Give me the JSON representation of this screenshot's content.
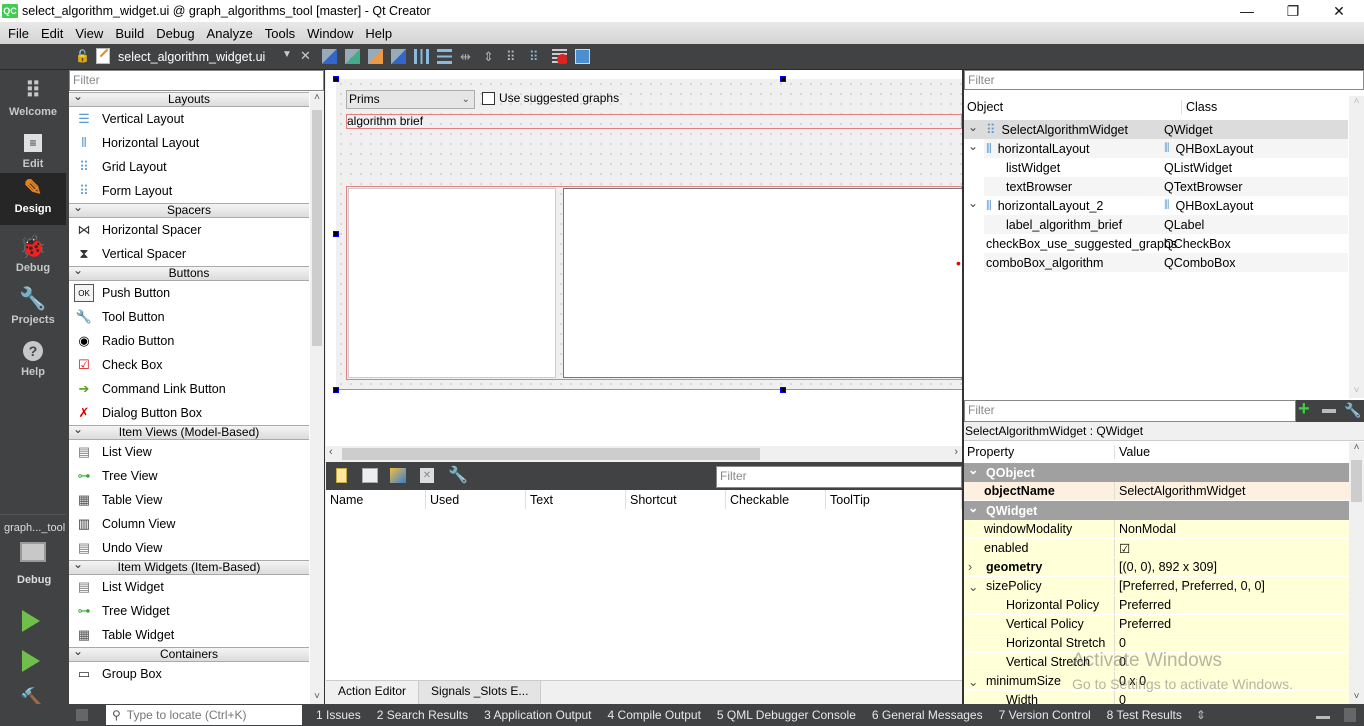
{
  "window": {
    "title": "select_algorithm_widget.ui @ graph_algorithms_tool [master] - Qt Creator",
    "app_icon": "QC",
    "minimize": "—",
    "restore": "❐",
    "close": "✕"
  },
  "menu": [
    "File",
    "Edit",
    "View",
    "Build",
    "Debug",
    "Analyze",
    "Tools",
    "Window",
    "Help"
  ],
  "doc_toolbar": {
    "file_name": "select_algorithm_widget.ui",
    "close_label": "✕"
  },
  "modes": [
    {
      "label": "Welcome",
      "icon": "grid-icon"
    },
    {
      "label": "Edit",
      "icon": "document-icon"
    },
    {
      "label": "Design",
      "icon": "pencil-icon"
    },
    {
      "label": "Debug",
      "icon": "bug-icon"
    },
    {
      "label": "Projects",
      "icon": "wrench-icon"
    },
    {
      "label": "Help",
      "icon": "help-icon"
    }
  ],
  "kit": {
    "project": "graph..._tool",
    "build": "Debug"
  },
  "widget_box": {
    "filter_placeholder": "Filter",
    "categories": [
      {
        "name": "Layouts",
        "items": [
          "Vertical Layout",
          "Horizontal Layout",
          "Grid Layout",
          "Form Layout"
        ]
      },
      {
        "name": "Spacers",
        "items": [
          "Horizontal Spacer",
          "Vertical Spacer"
        ]
      },
      {
        "name": "Buttons",
        "items": [
          "Push Button",
          "Tool Button",
          "Radio Button",
          "Check Box",
          "Command Link Button",
          "Dialog Button Box"
        ]
      },
      {
        "name": "Item Views (Model-Based)",
        "items": [
          "List View",
          "Tree View",
          "Table View",
          "Column View",
          "Undo View"
        ]
      },
      {
        "name": "Item Widgets (Item-Based)",
        "items": [
          "List Widget",
          "Tree Widget",
          "Table Widget"
        ]
      },
      {
        "name": "Containers",
        "items": [
          "Group Box"
        ]
      }
    ]
  },
  "form": {
    "combo_value": "Prims",
    "checkbox_label": "Use suggested graphs",
    "checkbox_checked": false,
    "label_text": "algorithm brief"
  },
  "action_editor": {
    "filter_placeholder": "Filter",
    "columns": [
      "Name",
      "Used",
      "Text",
      "Shortcut",
      "Checkable",
      "ToolTip"
    ],
    "tabs": [
      "Action Editor",
      "Signals _Slots E..."
    ]
  },
  "object_inspector": {
    "filter_placeholder": "Filter",
    "columns": [
      "Object",
      "Class"
    ],
    "rows": [
      {
        "name": "SelectAlgorithmWidget",
        "class": "QWidget"
      },
      {
        "name": "horizontalLayout",
        "class": "QHBoxLayout"
      },
      {
        "name": "listWidget",
        "class": "QListWidget"
      },
      {
        "name": "textBrowser",
        "class": "QTextBrowser"
      },
      {
        "name": "horizontalLayout_2",
        "class": "QHBoxLayout"
      },
      {
        "name": "label_algorithm_brief",
        "class": "QLabel"
      },
      {
        "name": "checkBox_use_suggested_graphs",
        "class": "QCheckBox"
      },
      {
        "name": "comboBox_algorithm",
        "class": "QComboBox"
      }
    ]
  },
  "property_editor": {
    "filter_placeholder": "Filter",
    "context": "SelectAlgorithmWidget : QWidget",
    "columns": [
      "Property",
      "Value"
    ],
    "groups": [
      {
        "name": "QObject"
      },
      {
        "name": "QWidget"
      }
    ],
    "rows": [
      {
        "name": "objectName",
        "value": "SelectAlgorithmWidget"
      },
      {
        "name": "windowModality",
        "value": "NonModal"
      },
      {
        "name": "enabled",
        "value": "☑"
      },
      {
        "name": "geometry",
        "value": "[(0, 0), 892 x 309]"
      },
      {
        "name": "sizePolicy",
        "value": "[Preferred, Preferred, 0, 0]"
      },
      {
        "name": "Horizontal Policy",
        "value": "Preferred"
      },
      {
        "name": "Vertical Policy",
        "value": "Preferred"
      },
      {
        "name": "Horizontal Stretch",
        "value": "0"
      },
      {
        "name": "Vertical Stretch",
        "value": "0"
      },
      {
        "name": "minimumSize",
        "value": "0 x 0"
      },
      {
        "name": "Width",
        "value": "0"
      }
    ]
  },
  "watermark": {
    "line1": "Activate Windows",
    "line2": "Go to Settings to activate Windows."
  },
  "status_bar": {
    "locator_placeholder": "Type to locate (Ctrl+K)",
    "outputs": [
      "1  Issues",
      "2  Search Results",
      "3  Application Output",
      "4  Compile Output",
      "5  QML Debugger Console",
      "6  General Messages",
      "7  Version Control",
      "8  Test Results"
    ]
  }
}
